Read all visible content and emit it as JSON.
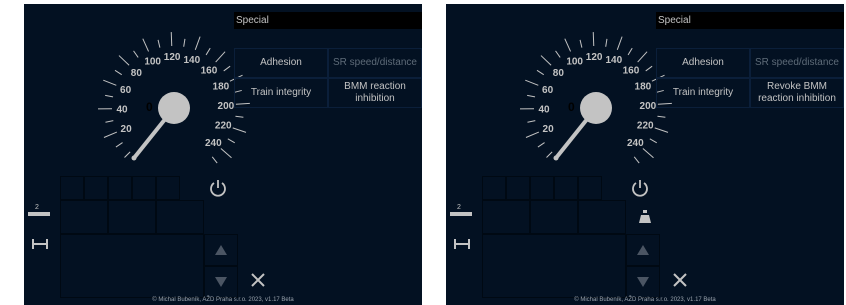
{
  "panels": [
    {
      "id": "left",
      "title": "Special",
      "speed": "0",
      "distance_label": "2",
      "buttons": [
        {
          "label": "Adhesion",
          "enabled": true
        },
        {
          "label": "SR speed/distance",
          "enabled": false
        },
        {
          "label": "Train integrity",
          "enabled": true
        },
        {
          "label": "BMM reaction inhibition",
          "enabled": true
        }
      ],
      "footer": "© Michal Bubeník, AŽD Praha s.r.o. 2023, v1.17 Beta"
    },
    {
      "id": "right",
      "title": "Special",
      "speed": "0",
      "distance_label": "2",
      "buttons": [
        {
          "label": "Adhesion",
          "enabled": true
        },
        {
          "label": "SR speed/distance",
          "enabled": false
        },
        {
          "label": "Train integrity",
          "enabled": true
        },
        {
          "label": "Revoke BMM reaction inhibition",
          "enabled": true
        }
      ],
      "footer": "© Michal Bubeník, AŽD Praha s.r.o. 2023, v1.17 Beta"
    }
  ],
  "gauge": {
    "labels": [
      "20",
      "40",
      "60",
      "80",
      "100",
      "120",
      "140",
      "160",
      "180",
      "200",
      "220",
      "240"
    ]
  },
  "colors": {
    "background": "#031122",
    "text": "#c3c3c3",
    "disabled_text": "#5e6b78",
    "needle": "#c3c3c3"
  },
  "icons": [
    "power-icon",
    "up-arrow-icon",
    "down-arrow-icon",
    "close-icon",
    "track-scale-icon",
    "level-crossing-icon"
  ]
}
